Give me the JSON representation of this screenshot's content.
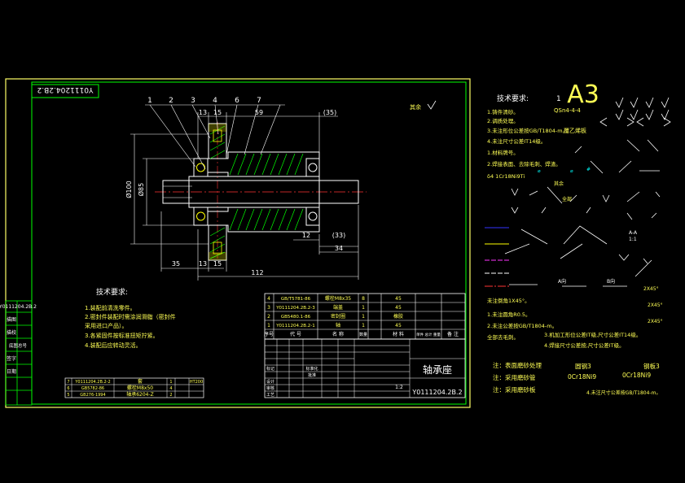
{
  "sheet": {
    "frame_code": "Y0111204.2B.2",
    "paper_size": "A3",
    "page_num": "1",
    "material_note": "QSn4-4-4",
    "roughness_mark": "其余"
  },
  "drawing": {
    "balloons": [
      "1",
      "2",
      "3",
      "4",
      "6",
      "7"
    ],
    "dims": {
      "d13": "13",
      "d15a": "15",
      "d59": "59",
      "d35top": "(35)",
      "d100": "Ø100",
      "d85": "Ø85",
      "d12": "12",
      "d33": "(33)",
      "d34": "34",
      "d35": "35",
      "d13b": "13",
      "d15b": "15",
      "d112": "112"
    }
  },
  "tech_left": {
    "title": "技术要求:",
    "lines": [
      "1.装配前清洗零件。",
      "2.密封件装配时需涂润滑脂（密封件",
      "    采用进口产品）。",
      "3.各紧固件按标准扭矩拧紧。",
      "4.装配后应转动灵活。"
    ]
  },
  "parts_table": {
    "rows": [
      [
        "4",
        "GB/T5781-86",
        "螺栓M8x35",
        "8",
        "",
        "45",
        ""
      ],
      [
        "3",
        "Y0111204.2B.2-3",
        "端盖",
        "1",
        "",
        "45",
        ""
      ],
      [
        "2",
        "GB5480.1-86",
        "密封圈",
        "1",
        "",
        "橡胶",
        ""
      ],
      [
        "1",
        "Y0111204.2B.2-1",
        "轴",
        "1",
        "",
        "45",
        ""
      ]
    ],
    "header": [
      "序号",
      "代 号",
      "名 称",
      "数量",
      "材 料",
      "单件 总计 重量",
      "备 注"
    ],
    "lower_rows": [
      [
        "7",
        "Y0111204.2B.2-2",
        "套",
        "1",
        "HT200"
      ],
      [
        "6",
        "GB5782-86",
        "螺栓M8x50",
        "4",
        ""
      ],
      [
        "5",
        "GB276-1994",
        "轴承6204-Z",
        "2",
        ""
      ]
    ]
  },
  "title_block": {
    "name": "轴承座",
    "code": "Y0111204.2B.2",
    "scale": "1:2",
    "row_labels": [
      "标记",
      "设计",
      "审核",
      "工艺"
    ],
    "sign_labels": [
      "标准化",
      "批准"
    ]
  },
  "left_strip": [
    "描图",
    "描校",
    "底图总号",
    "签字",
    "日期"
  ],
  "notes_right": {
    "title": "技术要求:",
    "lines": [
      "1.铸件清砂。",
      "2.调质处理。",
      "3.未注形位公差按GB/T1804-m。",
      "4.未注尺寸公差IT14级。",
      "1.材料牌号。",
      "2.焊接表面、去除毛刺、焊渣。",
      "δ4  1Cr18Ni9Ti"
    ],
    "plate_note": "覆乙烯板",
    "qita": "其余",
    "quanbu": "全部",
    "ratio": "1:1",
    "a_a": "A-A",
    "a_dir": "A向",
    "b_dir": "B向",
    "chamfer_note": "未注倒角1X45°。",
    "chamfers": [
      "2X45°",
      "2X45°",
      "2X45°"
    ],
    "n1": "1.未注圆角R0.5。",
    "n2": "2.未注公差按GB/T1804-m。",
    "n3": "全部去毛刺。",
    "n4": "3.机加工形位公差IT级,尺寸公差IT14级。",
    "n5": "4.焊接尺寸公差按,尺寸公差IT级。",
    "footer": [
      "注：表面磨砂处理",
      "注：采用磨砂管",
      "注：采用磨砂板"
    ],
    "steel_labels": [
      "圆钢3",
      "钢板3"
    ],
    "steel_grades": [
      "0Cr18Ni9",
      "0Cr18Ni9"
    ],
    "bottom_note": "4.未注尺寸公差按GB/T1804-m。"
  }
}
